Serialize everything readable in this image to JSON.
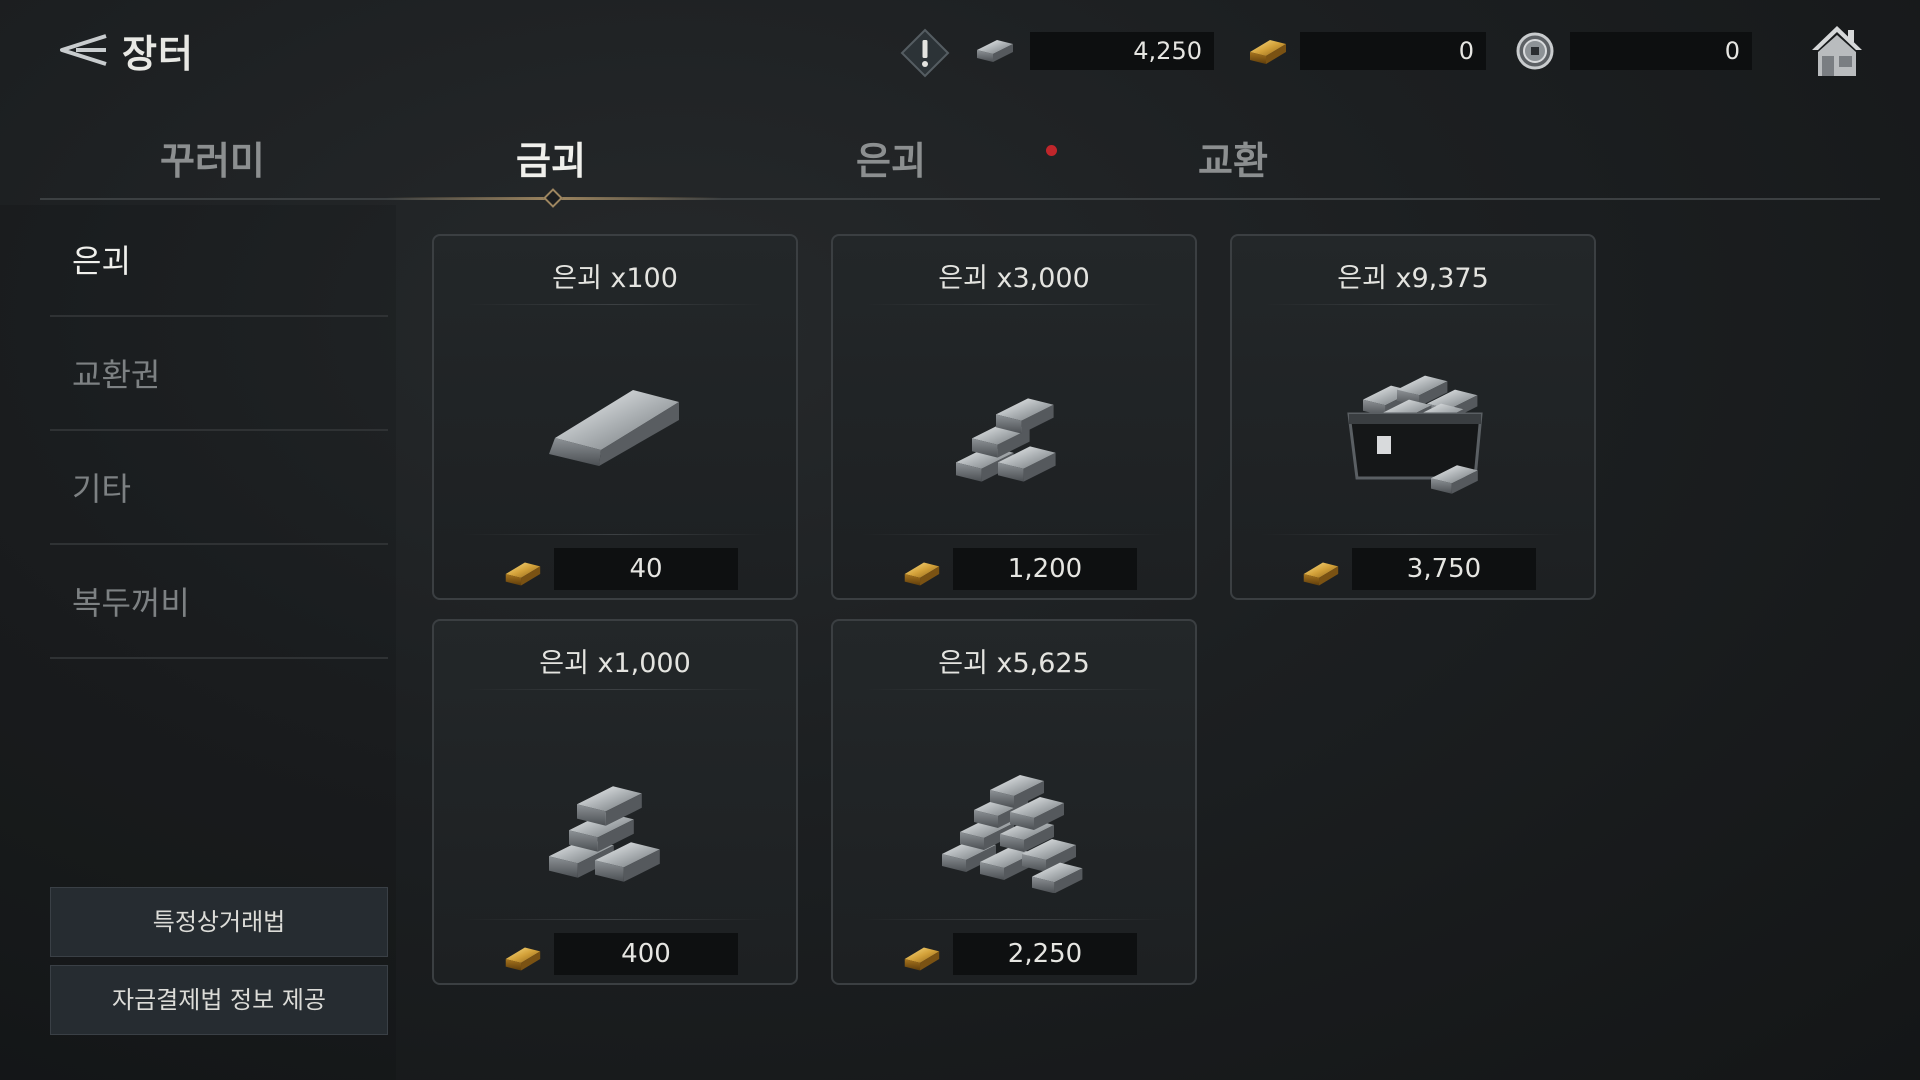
{
  "header": {
    "title": "장터",
    "back_icon": "back-arrow-icon",
    "warning_icon": "exclamation-icon",
    "home_icon": "home-icon"
  },
  "currencies": [
    {
      "icon": "silver-ingot-icon",
      "value": "4,250"
    },
    {
      "icon": "gold-ingot-icon",
      "value": "0"
    },
    {
      "icon": "coin-icon",
      "value": "0"
    }
  ],
  "tabs": [
    {
      "label": "꾸러미",
      "active": false
    },
    {
      "label": "금괴",
      "active": true
    },
    {
      "label": "은괴",
      "active": false,
      "badge": true
    },
    {
      "label": "교환",
      "active": false
    }
  ],
  "sidebar": {
    "items": [
      {
        "label": "은괴",
        "active": true
      },
      {
        "label": "교환권",
        "active": false
      },
      {
        "label": "기타",
        "active": false
      },
      {
        "label": "복두꺼비",
        "active": false
      }
    ],
    "buttons": [
      {
        "label": "특정상거래법"
      },
      {
        "label": "자금결제법 정보 제공"
      }
    ]
  },
  "products": [
    {
      "name": "은괴 x100",
      "art": "silver-ingot-single-icon",
      "price_icon": "gold-ingot-icon",
      "price": "40"
    },
    {
      "name": "은괴 x3,000",
      "art": "silver-ingot-pile-icon",
      "price_icon": "gold-ingot-icon",
      "price": "1,200"
    },
    {
      "name": "은괴 x9,375",
      "art": "silver-ingot-chest-icon",
      "price_icon": "gold-ingot-icon",
      "price": "3,750"
    },
    {
      "name": "은괴 x1,000",
      "art": "silver-ingot-stack-icon",
      "price_icon": "gold-ingot-icon",
      "price": "400"
    },
    {
      "name": "은괴 x5,625",
      "art": "silver-ingot-heap-icon",
      "price_icon": "gold-ingot-icon",
      "price": "2,250"
    }
  ],
  "colors": {
    "accent_gold": "#9e8660",
    "badge_red": "#c0262b",
    "silver": "#c9ccce",
    "gold": "#d4a23a"
  }
}
